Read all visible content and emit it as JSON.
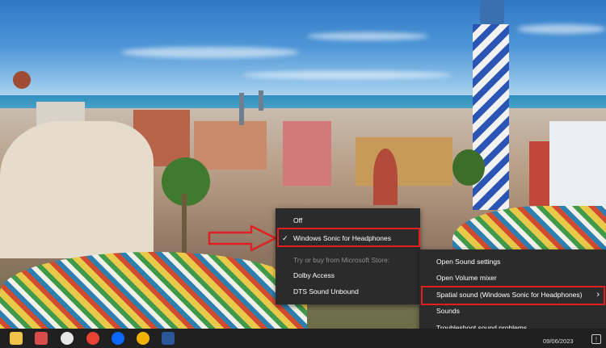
{
  "spatial_menu": {
    "items": [
      {
        "label": "Off",
        "checked": false,
        "enabled": true
      },
      {
        "label": "Windows Sonic for Headphones",
        "checked": true,
        "enabled": true
      },
      {
        "label": "Try or buy from Microsoft Store:",
        "checked": false,
        "enabled": false
      },
      {
        "label": "Dolby Access",
        "checked": false,
        "enabled": true
      },
      {
        "label": "DTS Sound Unbound",
        "checked": false,
        "enabled": true
      }
    ],
    "check_glyph": "✓"
  },
  "speaker_menu": {
    "items": [
      {
        "label": "Open Sound settings"
      },
      {
        "label": "Open Volume mixer"
      },
      {
        "label": "Spatial sound (Windows Sonic for Headphones)",
        "has_submenu": true
      },
      {
        "label": "Sounds"
      },
      {
        "label": "Troubleshoot sound problems"
      }
    ],
    "chevron_glyph": "›"
  },
  "highlight_color": "#e02020",
  "taskbar": {
    "icons": [
      {
        "name": "file-explorer-icon",
        "color": "#f2c24a"
      },
      {
        "name": "snipping-tool-icon",
        "color": "#d84c4c"
      },
      {
        "name": "paint-icon",
        "color": "#e8e8e8"
      },
      {
        "name": "chrome-icon",
        "color": "#e94235"
      },
      {
        "name": "zalo-icon",
        "color": "#0a68ff"
      },
      {
        "name": "chrome-profile-icon",
        "color": "#f0b400"
      },
      {
        "name": "word-icon",
        "color": "#2b579a"
      }
    ],
    "date": "09/06/2023",
    "notification_glyph": "!"
  }
}
